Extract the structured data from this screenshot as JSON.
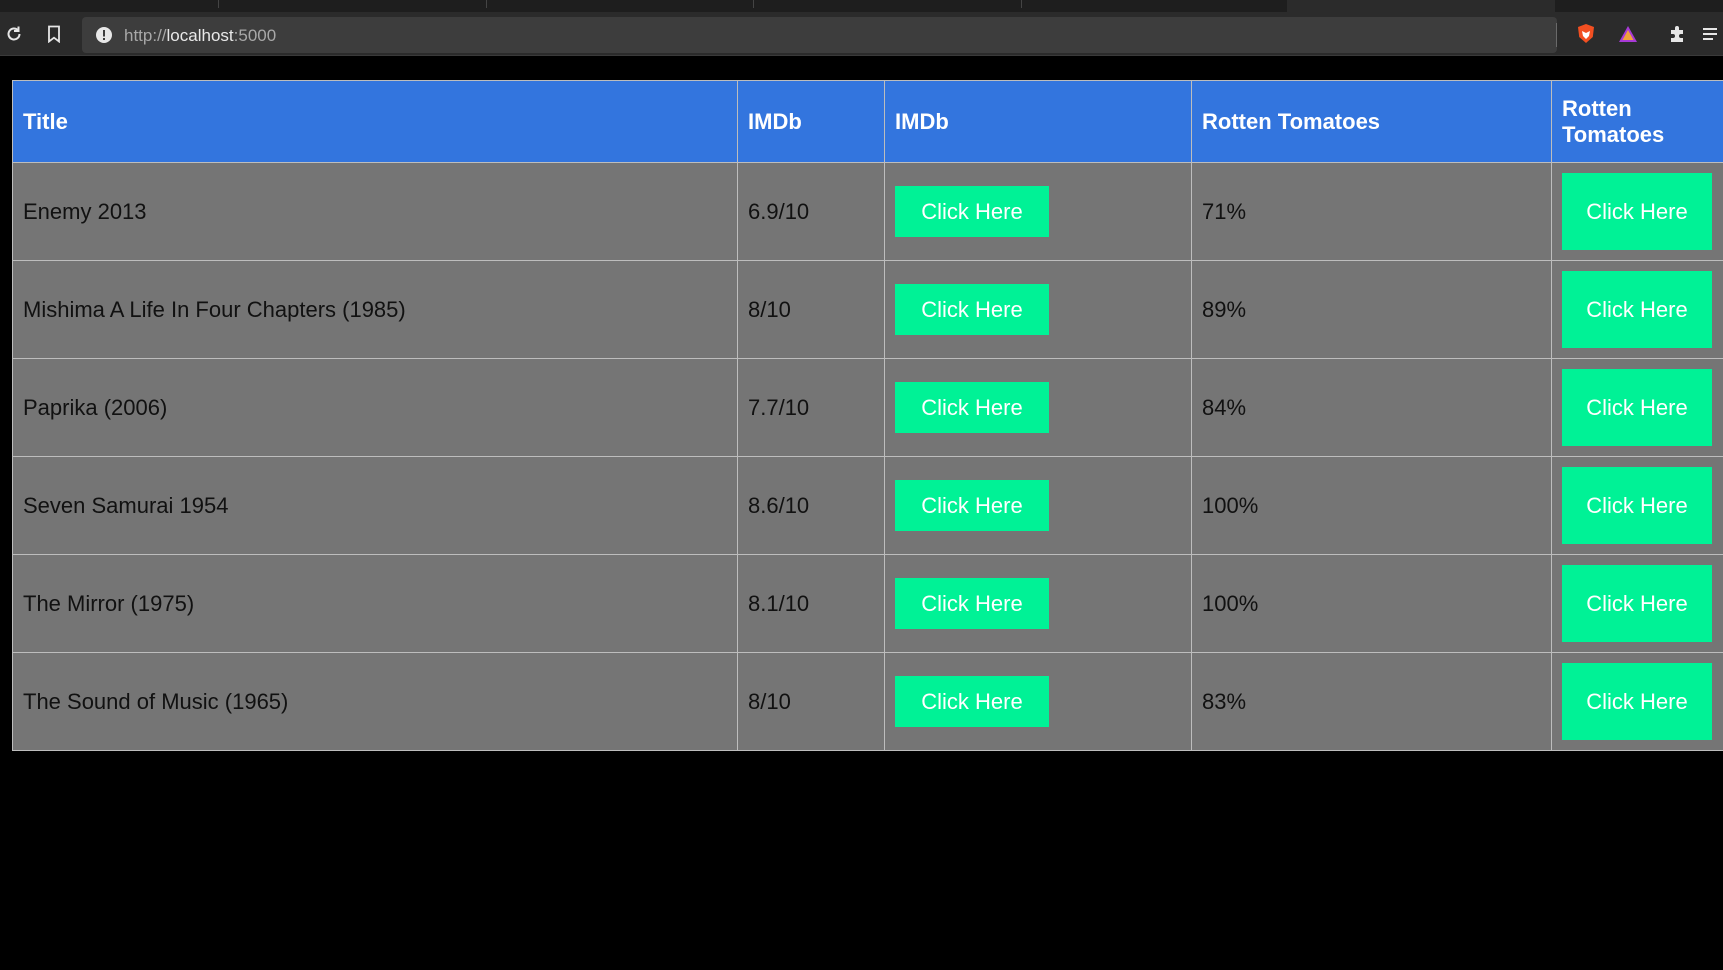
{
  "browser": {
    "url_host": "http://",
    "url_domain": "localhost",
    "url_port": ":5000"
  },
  "icons": {
    "reload": "reload-icon",
    "bookmark": "bookmark-icon",
    "site_info": "info-icon",
    "brave_shield": "brave-shield-icon",
    "brave_rewards": "brave-rewards-icon",
    "extensions": "puzzle-icon",
    "menu": "menu-icon"
  },
  "colors": {
    "header_bg": "#3375de",
    "row_bg": "#757575",
    "button_bg": "#00f296"
  },
  "table": {
    "headers": [
      "Title",
      "IMDb",
      "IMDb",
      "Rotten Tomatoes",
      "Rotten Tomatoes"
    ],
    "button_label": "Click Here",
    "rows": [
      {
        "title": "Enemy 2013",
        "imdb": "6.9/10",
        "rt": "71%"
      },
      {
        "title": "Mishima A Life In Four Chapters (1985)",
        "imdb": "8/10",
        "rt": "89%"
      },
      {
        "title": "Paprika (2006)",
        "imdb": "7.7/10",
        "rt": "84%"
      },
      {
        "title": "Seven Samurai 1954",
        "imdb": "8.6/10",
        "rt": "100%"
      },
      {
        "title": "The Mirror (1975)",
        "imdb": "8.1/10",
        "rt": "100%"
      },
      {
        "title": "The Sound of Music (1965)",
        "imdb": "8/10",
        "rt": "83%"
      }
    ]
  }
}
